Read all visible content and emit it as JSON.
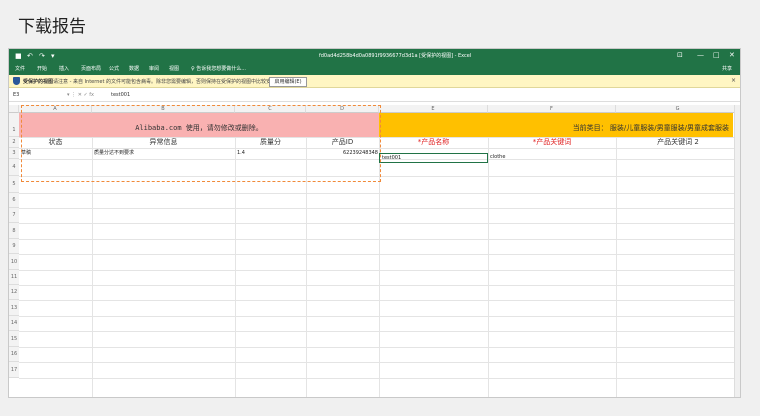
{
  "page": {
    "title": "下载报告"
  },
  "window": {
    "title": "fd0ad4d258b4d0a0891f9936677d3d1a  [受保护的视图] - Excel",
    "controls": [
      "⊡",
      "—",
      "□",
      "✕"
    ],
    "share_label": "共享",
    "qat": [
      "■",
      "↶",
      "↷",
      "▾"
    ]
  },
  "menu": [
    "文件",
    "开始",
    "插入",
    "页面布局",
    "公式",
    "数据",
    "审阅",
    "视图",
    "♀ 告诉我您想要做什么..."
  ],
  "protected_view": {
    "label": "受保护的视图",
    "message": "请注意 - 来自 Internet 的文件可能包含病毒。除非您需要编辑，否则保持在受保护的视图中比较安全。",
    "button": "启用编辑(E)",
    "close": "×"
  },
  "formula_bar": {
    "name_box": "E3",
    "icons": "▾   ⋮  ✕  ✓  fx",
    "value": "test001"
  },
  "columns": [
    "A",
    "B",
    "C",
    "D",
    "E",
    "F",
    "G"
  ],
  "rows": [
    "1",
    "2",
    "3",
    "4",
    "5",
    "6",
    "7",
    "8",
    "9",
    "10",
    "11",
    "12",
    "13",
    "14",
    "15",
    "16",
    "17"
  ],
  "sheet": {
    "banner_left": "Alibaba.com 使用，请勿修改或删除。",
    "banner_right": "当前类目： 服装/儿童服装/男童服装/男童成套服装",
    "headers": [
      "状态",
      "异常信息",
      "质量分",
      "产品ID",
      "*产品名称",
      "*产品关键词",
      "产品关键词 2"
    ],
    "row3": [
      "草稿",
      "质量分达不到要求",
      "1.4",
      "62239248348",
      "test001",
      "clothe",
      ""
    ]
  },
  "colors": {
    "excel_green": "#217346",
    "pink": "#f9b1b1",
    "yellow": "#ffc000",
    "dash": "#f08a3a"
  }
}
